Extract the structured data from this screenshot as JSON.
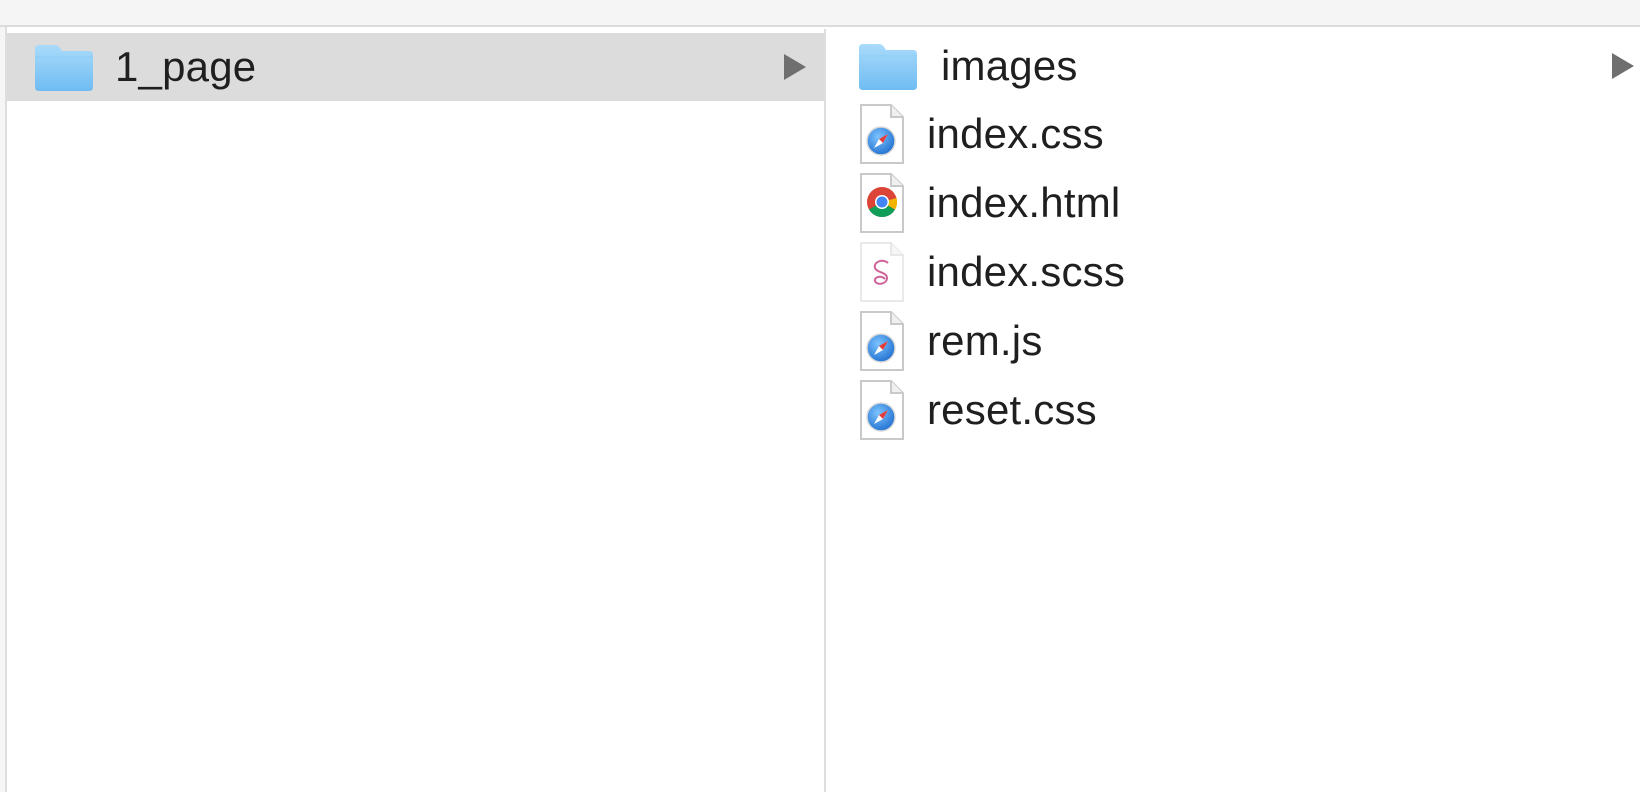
{
  "window": {
    "columns": [
      {
        "items": [
          {
            "name": "1_page",
            "icon": "folder-icon",
            "selected": true,
            "has_children": true
          }
        ]
      },
      {
        "items": [
          {
            "name": "images",
            "icon": "folder-icon",
            "selected": false,
            "has_children": true
          },
          {
            "name": "index.css",
            "icon": "safari-document-icon",
            "selected": false,
            "has_children": false
          },
          {
            "name": "index.html",
            "icon": "chrome-document-icon",
            "selected": false,
            "has_children": false
          },
          {
            "name": "index.scss",
            "icon": "sass-document-icon",
            "selected": false,
            "has_children": false
          },
          {
            "name": "rem.js",
            "icon": "safari-document-icon",
            "selected": false,
            "has_children": false
          },
          {
            "name": "reset.css",
            "icon": "safari-document-icon",
            "selected": false,
            "has_children": false
          }
        ]
      }
    ]
  },
  "colors": {
    "folder": "#7cc4f5",
    "folder_tab": "#9ad3fa",
    "selection": "#dcdcdc",
    "safari_blue": "#2e7fd6",
    "disclosure": "#6f6f6f"
  }
}
